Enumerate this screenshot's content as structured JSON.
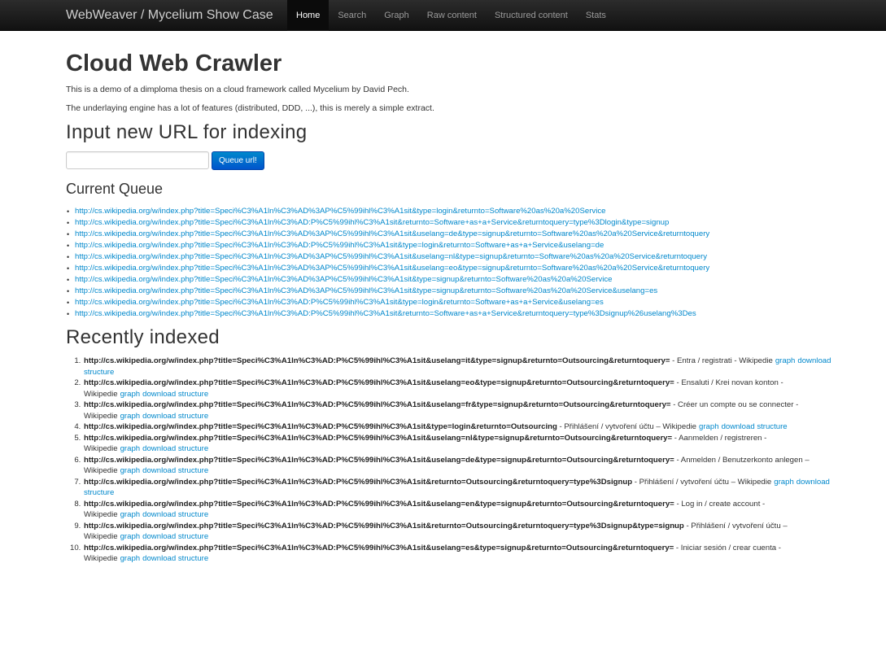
{
  "navbar": {
    "brand": "WebWeaver / Mycelium Show Case",
    "items": [
      {
        "label": "Home"
      },
      {
        "label": "Search"
      },
      {
        "label": "Graph"
      },
      {
        "label": "Raw content"
      },
      {
        "label": "Structured content"
      },
      {
        "label": "Stats"
      }
    ]
  },
  "main": {
    "title": "Cloud Web Crawler",
    "intro1": "This is a demo of a dimploma thesis on a cloud framework called Mycelium by David Pech.",
    "intro2": "The underlaying engine has a lot of features (distributed, DDD, ...), this is merely a simple extract.",
    "input_heading": "Input new URL for indexing",
    "url_input_value": "",
    "queue_button": "Queue url!",
    "queue_heading": "Current Queue",
    "queue": [
      "http://cs.wikipedia.org/w/index.php?title=Speci%C3%A1ln%C3%AD%3AP%C5%99ihl%C3%A1sit&type=login&returnto=Software%20as%20a%20Service",
      "http://cs.wikipedia.org/w/index.php?title=Speci%C3%A1ln%C3%AD:P%C5%99ihl%C3%A1sit&returnto=Software+as+a+Service&returntoquery=type%3Dlogin&type=signup",
      "http://cs.wikipedia.org/w/index.php?title=Speci%C3%A1ln%C3%AD%3AP%C5%99ihl%C3%A1sit&uselang=de&type=signup&returnto=Software%20as%20a%20Service&returntoquery",
      "http://cs.wikipedia.org/w/index.php?title=Speci%C3%A1ln%C3%AD:P%C5%99ihl%C3%A1sit&type=login&returnto=Software+as+a+Service&uselang=de",
      "http://cs.wikipedia.org/w/index.php?title=Speci%C3%A1ln%C3%AD%3AP%C5%99ihl%C3%A1sit&uselang=nl&type=signup&returnto=Software%20as%20a%20Service&returntoquery",
      "http://cs.wikipedia.org/w/index.php?title=Speci%C3%A1ln%C3%AD%3AP%C5%99ihl%C3%A1sit&uselang=eo&type=signup&returnto=Software%20as%20a%20Service&returntoquery",
      "http://cs.wikipedia.org/w/index.php?title=Speci%C3%A1ln%C3%AD%3AP%C5%99ihl%C3%A1sit&type=signup&returnto=Software%20as%20a%20Service",
      "http://cs.wikipedia.org/w/index.php?title=Speci%C3%A1ln%C3%AD%3AP%C5%99ihl%C3%A1sit&type=signup&returnto=Software%20as%20a%20Service&uselang=es",
      "http://cs.wikipedia.org/w/index.php?title=Speci%C3%A1ln%C3%AD:P%C5%99ihl%C3%A1sit&type=login&returnto=Software+as+a+Service&uselang=es",
      "http://cs.wikipedia.org/w/index.php?title=Speci%C3%A1ln%C3%AD:P%C5%99ihl%C3%A1sit&returnto=Software+as+a+Service&returntoquery=type%3Dsignup%26uselang%3Des"
    ],
    "indexed_heading": "Recently indexed",
    "graph_label": "graph",
    "download_label": "download structure",
    "indexed": [
      {
        "url": "http://cs.wikipedia.org/w/index.php?title=Speci%C3%A1ln%C3%AD:P%C5%99ihl%C3%A1sit&uselang=it&type=signup&returnto=Outsourcing&returntoquery=",
        "title": " - Entra / registrati - Wikipedie"
      },
      {
        "url": "http://cs.wikipedia.org/w/index.php?title=Speci%C3%A1ln%C3%AD:P%C5%99ihl%C3%A1sit&uselang=eo&type=signup&returnto=Outsourcing&returntoquery=",
        "title": " - Ensaluti / Krei novan konton - Wikipedie"
      },
      {
        "url": "http://cs.wikipedia.org/w/index.php?title=Speci%C3%A1ln%C3%AD:P%C5%99ihl%C3%A1sit&uselang=fr&type=signup&returnto=Outsourcing&returntoquery=",
        "title": " - Créer un compte ou se connecter - Wikipedie"
      },
      {
        "url": "http://cs.wikipedia.org/w/index.php?title=Speci%C3%A1ln%C3%AD:P%C5%99ihl%C3%A1sit&type=login&returnto=Outsourcing",
        "title": " - Přihlášení / vytvoření účtu – Wikipedie"
      },
      {
        "url": "http://cs.wikipedia.org/w/index.php?title=Speci%C3%A1ln%C3%AD:P%C5%99ihl%C3%A1sit&uselang=nl&type=signup&returnto=Outsourcing&returntoquery=",
        "title": " - Aanmelden / registreren - Wikipedie"
      },
      {
        "url": "http://cs.wikipedia.org/w/index.php?title=Speci%C3%A1ln%C3%AD:P%C5%99ihl%C3%A1sit&uselang=de&type=signup&returnto=Outsourcing&returntoquery=",
        "title": " - Anmelden / Benutzerkonto anlegen – Wikipedie"
      },
      {
        "url": "http://cs.wikipedia.org/w/index.php?title=Speci%C3%A1ln%C3%AD:P%C5%99ihl%C3%A1sit&returnto=Outsourcing&returntoquery=type%3Dsignup",
        "title": " - Přihlášení / vytvoření účtu – Wikipedie"
      },
      {
        "url": "http://cs.wikipedia.org/w/index.php?title=Speci%C3%A1ln%C3%AD:P%C5%99ihl%C3%A1sit&uselang=en&type=signup&returnto=Outsourcing&returntoquery=",
        "title": " - Log in / create account - Wikipedie"
      },
      {
        "url": "http://cs.wikipedia.org/w/index.php?title=Speci%C3%A1ln%C3%AD:P%C5%99ihl%C3%A1sit&returnto=Outsourcing&returntoquery=type%3Dsignup&type=signup",
        "title": " - Přihlášení / vytvoření účtu – Wikipedie"
      },
      {
        "url": "http://cs.wikipedia.org/w/index.php?title=Speci%C3%A1ln%C3%AD:P%C5%99ihl%C3%A1sit&uselang=es&type=signup&returnto=Outsourcing&returntoquery=",
        "title": " - Iniciar sesión / crear cuenta - Wikipedie"
      }
    ]
  },
  "colors": {
    "navbar": "#1b1b1b",
    "link": "#0088cc",
    "primary_button": "#0074cc"
  }
}
